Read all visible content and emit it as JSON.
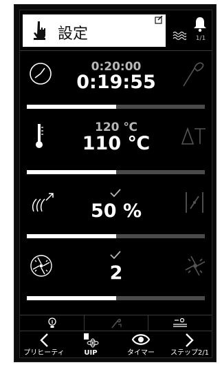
{
  "header": {
    "title": "設定",
    "step_counter": "1/1"
  },
  "timer": {
    "set_value": "0:20:00",
    "actual_value": "0:19:55",
    "progress": 0.5
  },
  "temperature": {
    "set_value": "120 ℃",
    "actual_value": "110 ℃",
    "progress": 0.5
  },
  "humidity": {
    "actual_value": "50 %",
    "progress": 0.5
  },
  "fan": {
    "actual_value": "2",
    "progress": 0.5
  },
  "nav": {
    "preheat_label": "プリヒーティ",
    "uip_label": "UIP",
    "timer_label": "タイマー",
    "step_label": "ステップ2/1"
  },
  "colors": {
    "background": "#000000",
    "text": "#ffffff",
    "muted": "#b8b8b8",
    "bar_track": "#4a4a4a",
    "bar_fill": "#ffffff"
  }
}
